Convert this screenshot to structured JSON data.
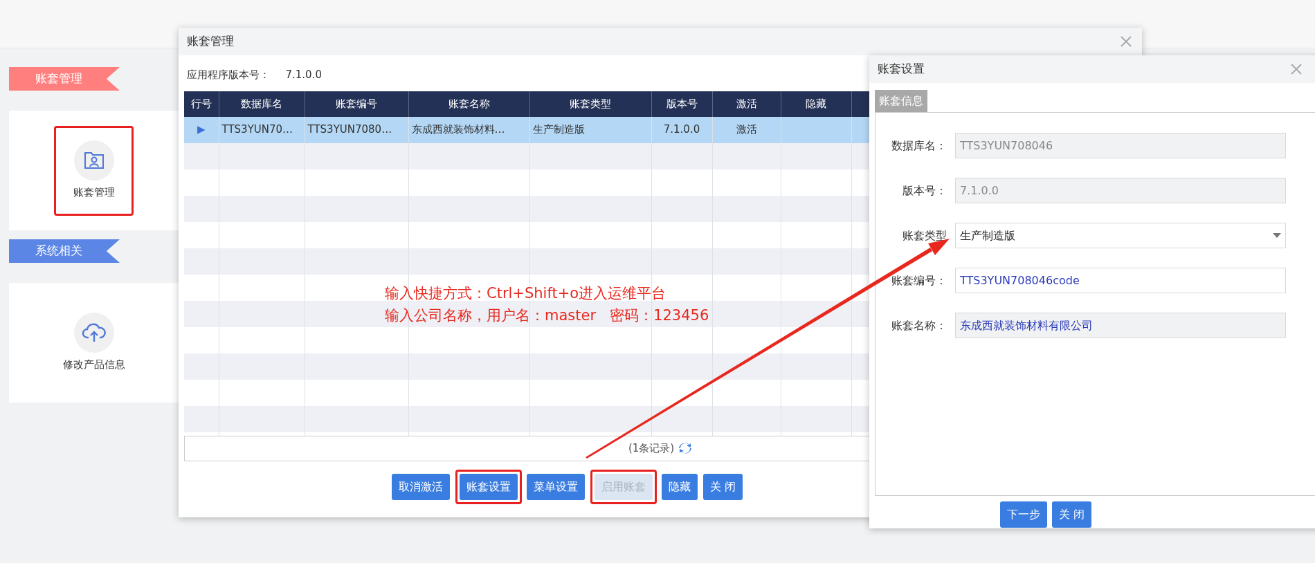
{
  "sidebar": {
    "sections": [
      {
        "title": "账套管理",
        "color": "#ff7f7f",
        "items": [
          {
            "label": "账套管理",
            "kind": "folder",
            "highlighted": true
          }
        ]
      },
      {
        "title": "系统相关",
        "color": "#5b86e5",
        "items": [
          {
            "label": "修改产品信息",
            "kind": "cloud",
            "highlighted": false
          }
        ]
      }
    ]
  },
  "main_dialog": {
    "title": "账套管理",
    "version_label": "应用程序版本号：",
    "version": "7.1.0.0",
    "table": {
      "columns": [
        "行号",
        "数据库名",
        "账套编号",
        "账套名称",
        "账套类型",
        "版本号",
        "激活",
        "隐藏"
      ],
      "rows": [
        {
          "selected": true,
          "cells": [
            "▶",
            "TTS3YUN70…",
            "TTS3YUN7080…",
            "东成西就装饰材料…",
            "生产制造版",
            "7.1.0.0",
            "激活",
            ""
          ]
        }
      ]
    },
    "record_count": "(1条记录)",
    "buttons": [
      {
        "label": "取消激活",
        "disabled": false,
        "highlighted": false
      },
      {
        "label": "账套设置",
        "disabled": false,
        "highlighted": true
      },
      {
        "label": "菜单设置",
        "disabled": false,
        "highlighted": false
      },
      {
        "label": "启用账套",
        "disabled": true,
        "highlighted": true
      },
      {
        "label": "隐藏",
        "disabled": false,
        "highlighted": false
      },
      {
        "label": "关 闭",
        "disabled": false,
        "highlighted": false
      }
    ]
  },
  "annotation": {
    "lines": [
      "输入快捷方式：Ctrl+Shift+o进入运维平台",
      "输入公司名称，用户名：master   密码：123456"
    ]
  },
  "settings_dialog": {
    "title": "账套设置",
    "tab": "账套信息",
    "fields": [
      {
        "label": "数据库名：",
        "value": "TTS3YUN708046",
        "kind": "readonly"
      },
      {
        "label": "版本号：",
        "value": "7.1.0.0",
        "kind": "readonly"
      },
      {
        "label": "账套类型",
        "value": "生产制造版",
        "kind": "select"
      },
      {
        "label": "账套编号：",
        "value": "TTS3YUN708046code",
        "kind": "text"
      },
      {
        "label": "账套名称：",
        "value": "东成西就装饰材料有限公司",
        "kind": "locked"
      }
    ],
    "buttons": [
      {
        "label": "下一步"
      },
      {
        "label": "关 闭"
      }
    ]
  }
}
